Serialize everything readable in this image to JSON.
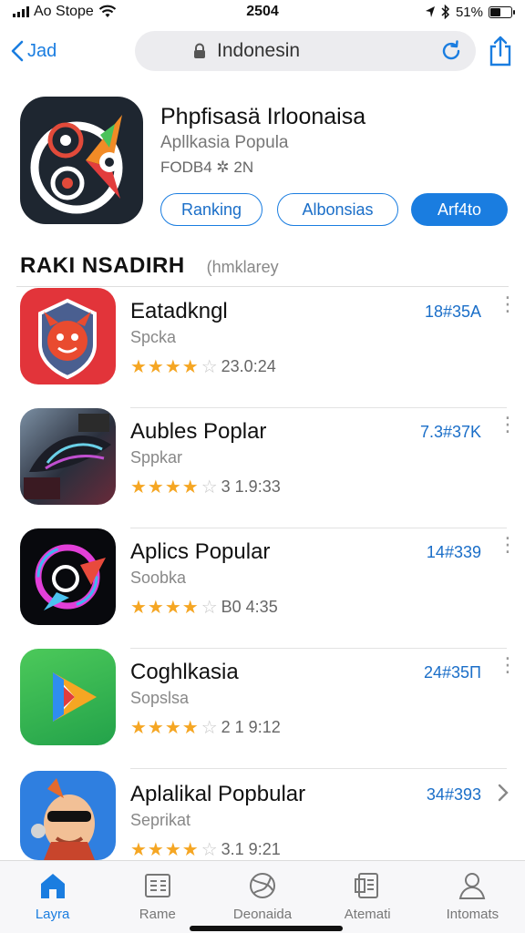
{
  "status_bar": {
    "carrier": "Ao Stope",
    "time": "2504",
    "battery": "51%",
    "battery_level": 0.51
  },
  "nav": {
    "back_label": "Jad",
    "search_value": "Indonesin"
  },
  "hero": {
    "title": "Phpfisasä Irloonaisa",
    "subtitle": "Apllkasia Popula",
    "code": "FODB4 ✲ 2N",
    "chips": [
      "Ranking",
      "Albonsias",
      "Arf4to"
    ]
  },
  "section": {
    "title": "RAKI NSADIRH",
    "subtitle": "(hmklarey"
  },
  "apps": [
    {
      "name": "Eatadkngl",
      "category": "Spcka",
      "rating_text": "23.0:24",
      "stars": 4,
      "count": "18#35A",
      "action": "more"
    },
    {
      "name": "Aubles Poplar",
      "category": "Sppkar",
      "rating_text": "3 1.9:33",
      "stars": 4,
      "count": "7.3#37K",
      "action": "more"
    },
    {
      "name": "Aplics Popular",
      "category": "Soobka",
      "rating_text": "B0 4:35",
      "stars": 4,
      "count": "14#339",
      "action": "more"
    },
    {
      "name": "Coghlkasia",
      "category": "Sopslsa",
      "rating_text": "2 1 9:12",
      "stars": 4,
      "count": "24#35П",
      "action": "more"
    },
    {
      "name": "Aplalikal Popbular",
      "category": "Seprikat",
      "rating_text": "3.1 9:21",
      "stars": 4,
      "count": "34#393",
      "action": "chevron"
    }
  ],
  "tabs": [
    {
      "label": "Layra",
      "icon": "home-icon",
      "active": true
    },
    {
      "label": "Rame",
      "icon": "list-card-icon",
      "active": false
    },
    {
      "label": "Deonaida",
      "icon": "globe-icon",
      "active": false
    },
    {
      "label": "Atemati",
      "icon": "document-icon",
      "active": false
    },
    {
      "label": "Intomats",
      "icon": "person-icon",
      "active": false
    }
  ],
  "colors": {
    "accent": "#1a7de0",
    "star": "#f5a623",
    "text_secondary": "#888888"
  }
}
